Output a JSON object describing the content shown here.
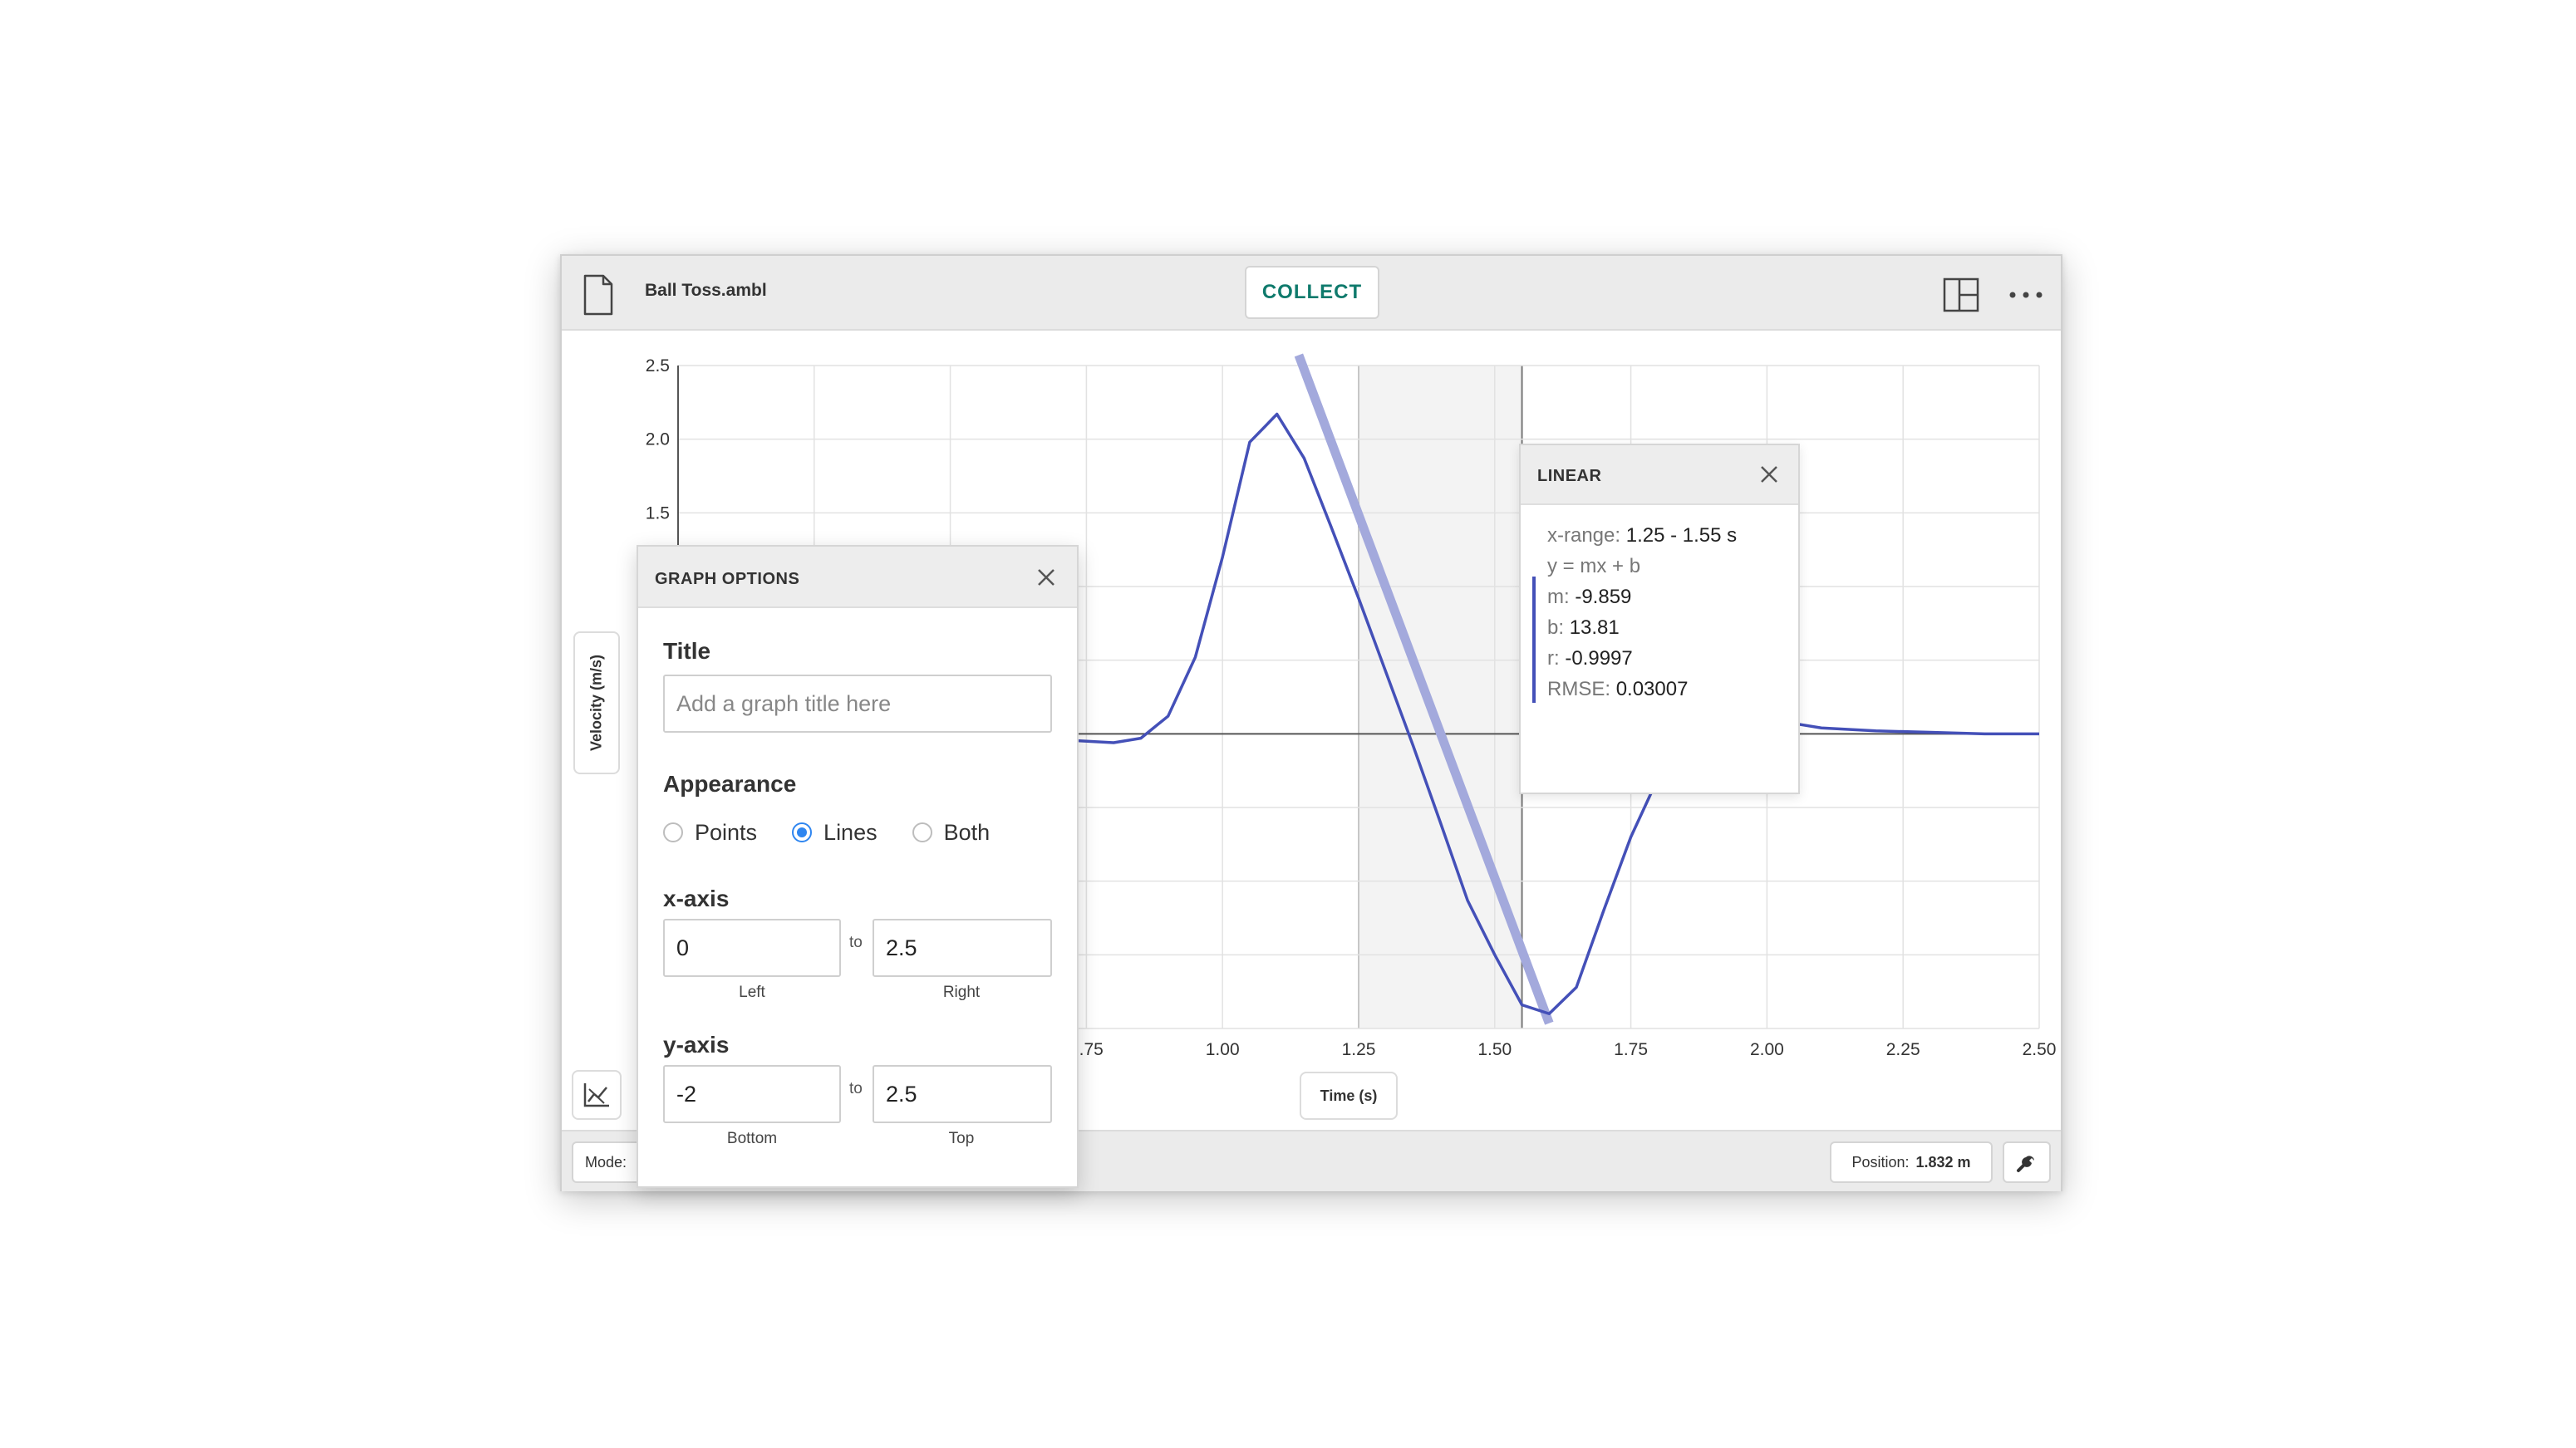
{
  "app": {
    "filename": "Ball Toss.ambl",
    "collect_label": "COLLECT"
  },
  "axes": {
    "y_label": "Velocity (m/s)",
    "x_label": "Time (s)"
  },
  "footer": {
    "mode_label": "Mode:",
    "position_label": "Position:",
    "position_value": "1.832 m"
  },
  "linear_fit": {
    "title": "LINEAR",
    "xrange_label": "x-range:",
    "xrange_value": "1.25 - 1.55 s",
    "equation": "y = mx + b",
    "m_label": "m:",
    "m_value": "-9.859",
    "b_label": "b:",
    "b_value": "13.81",
    "r_label": "r:",
    "r_value": "-0.9997",
    "rmse_label": "RMSE:",
    "rmse_value": "0.03007"
  },
  "graph_options": {
    "title": "GRAPH OPTIONS",
    "title_label": "Title",
    "title_placeholder": "Add a graph title here",
    "appearance_label": "Appearance",
    "appearance_options": [
      "Points",
      "Lines",
      "Both"
    ],
    "appearance_selected": "Lines",
    "xaxis_label": "x-axis",
    "x_left": "0",
    "x_right": "2.5",
    "x_left_caption": "Left",
    "x_right_caption": "Right",
    "yaxis_label": "y-axis",
    "y_bottom": "-2",
    "y_top": "2.5",
    "y_bottom_caption": "Bottom",
    "y_top_caption": "Top",
    "to_label": "to"
  },
  "chart_data": {
    "type": "line",
    "xlabel": "Time (s)",
    "ylabel": "Velocity (m/s)",
    "xlim": [
      0,
      2.5
    ],
    "ylim": [
      -2,
      2.5
    ],
    "x_ticks": [
      "0.75",
      "1.00",
      "1.25",
      "1.50",
      "1.75",
      "2.00",
      "2.25",
      "2.50"
    ],
    "y_ticks": [
      "2.5",
      "2.0",
      "1.5"
    ],
    "selection_range": [
      1.25,
      1.55
    ],
    "colors": {
      "series": "#4450b8",
      "fit": "#a3a9dc",
      "selection": "#f3f3f3"
    },
    "series": [
      {
        "x": [
          0.7,
          0.8,
          0.85,
          0.9,
          0.95,
          1.0,
          1.05,
          1.1,
          1.15,
          1.2,
          1.25,
          1.3,
          1.35,
          1.4,
          1.45,
          1.5,
          1.55,
          1.6,
          1.65,
          1.7,
          1.75,
          1.8,
          1.85,
          2.0,
          2.05,
          2.1,
          2.15,
          2.2,
          2.3,
          2.4,
          2.5
        ],
        "y": [
          -0.04,
          -0.06,
          -0.03,
          0.12,
          0.52,
          1.2,
          1.98,
          2.17,
          1.87,
          1.4,
          0.92,
          0.42,
          -0.08,
          -0.6,
          -1.13,
          -1.5,
          -1.84,
          -1.9,
          -1.72,
          -1.2,
          -0.7,
          -0.3,
          -0.1,
          0.1,
          0.07,
          0.04,
          0.03,
          0.02,
          0.01,
          0.0,
          0.0
        ]
      }
    ],
    "fit": {
      "m": -9.859,
      "b": 13.81,
      "x_from": 1.14,
      "x_to": 1.6
    }
  }
}
